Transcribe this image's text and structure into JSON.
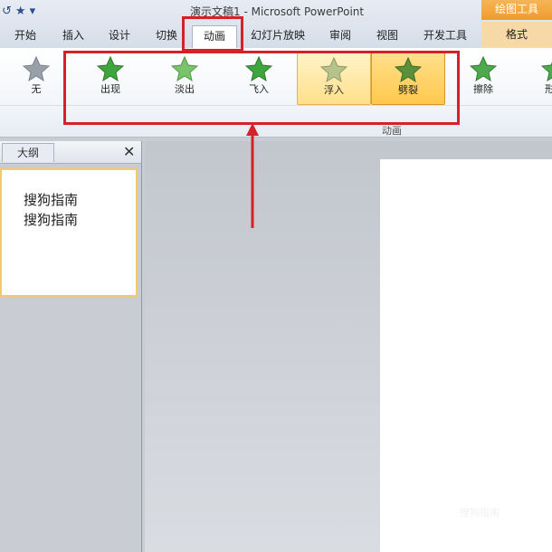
{
  "window": {
    "title": "演示文稿1 - Microsoft PowerPoint",
    "context_tab": "绘图工具"
  },
  "qat": {
    "undo_glyph": "↺",
    "star_glyph": "★",
    "dropdown_glyph": "▾"
  },
  "tabs": [
    "开始",
    "插入",
    "设计",
    "切换",
    "动画",
    "幻灯片放映",
    "审阅",
    "视图",
    "开发工具",
    "格式"
  ],
  "gallery": {
    "items": [
      {
        "label": "无",
        "color": "#9aa0a8"
      },
      {
        "label": "出现",
        "color": "#3fa63f"
      },
      {
        "label": "淡出",
        "color": "#7ac26c"
      },
      {
        "label": "飞入",
        "color": "#3fa63f"
      },
      {
        "label": "浮入",
        "color": "#c7c9a4"
      },
      {
        "label": "劈裂",
        "color": "#5a8f3c"
      },
      {
        "label": "擦除",
        "color": "#4ea94e"
      },
      {
        "label": "形",
        "color": "#4ea94e"
      }
    ],
    "group_label": "动画"
  },
  "outline": {
    "tab_label": "大纲",
    "close_glyph": "✕"
  },
  "thumbnail": {
    "lines": [
      "搜狗指南",
      "搜狗指南"
    ]
  },
  "watermark": "搜狗指南"
}
